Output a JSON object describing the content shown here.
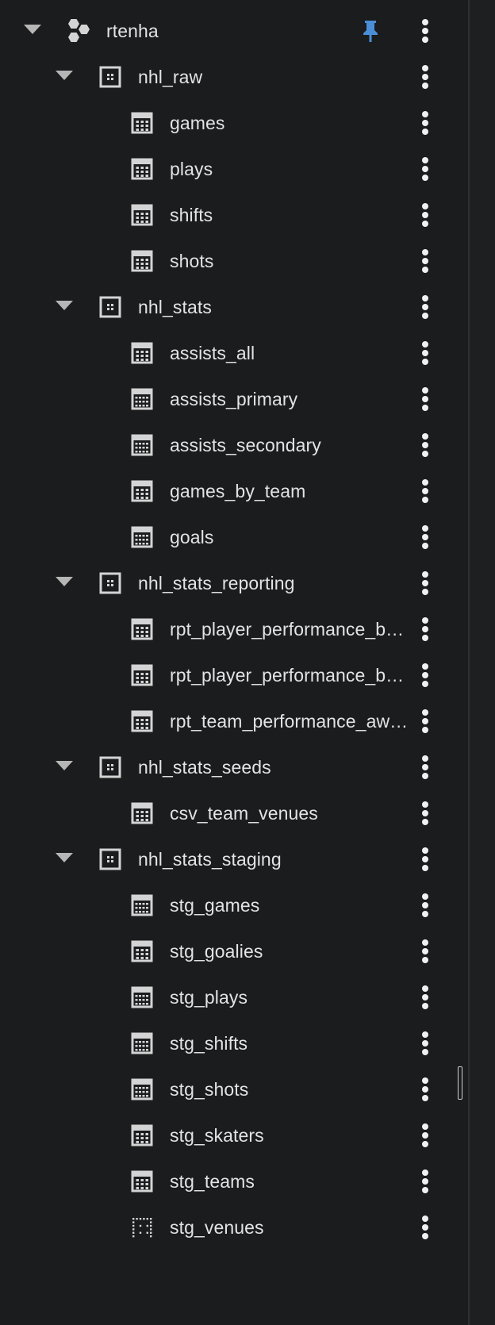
{
  "project": {
    "name": "rtenha",
    "icon": "project-hexagons-icon",
    "pinned": true,
    "pin_color": "#4a8ed8"
  },
  "datasets": [
    {
      "name": "nhl_raw",
      "tables": [
        {
          "name": "games",
          "icon": "table-icon"
        },
        {
          "name": "plays",
          "icon": "table-icon"
        },
        {
          "name": "shifts",
          "icon": "table-icon"
        },
        {
          "name": "shots",
          "icon": "table-icon"
        }
      ]
    },
    {
      "name": "nhl_stats",
      "tables": [
        {
          "name": "assists_all",
          "icon": "table-icon"
        },
        {
          "name": "assists_primary",
          "icon": "view-icon"
        },
        {
          "name": "assists_secondary",
          "icon": "view-icon"
        },
        {
          "name": "games_by_team",
          "icon": "table-icon"
        },
        {
          "name": "goals",
          "icon": "view-icon"
        }
      ]
    },
    {
      "name": "nhl_stats_reporting",
      "tables": [
        {
          "name": "rpt_player_performance_b…",
          "icon": "table-icon"
        },
        {
          "name": "rpt_player_performance_b…",
          "icon": "table-icon"
        },
        {
          "name": "rpt_team_performance_aw…",
          "icon": "table-icon"
        }
      ]
    },
    {
      "name": "nhl_stats_seeds",
      "tables": [
        {
          "name": "csv_team_venues",
          "icon": "table-icon"
        }
      ]
    },
    {
      "name": "nhl_stats_staging",
      "tables": [
        {
          "name": "stg_games",
          "icon": "view-icon"
        },
        {
          "name": "stg_goalies",
          "icon": "table-icon"
        },
        {
          "name": "stg_plays",
          "icon": "view-icon"
        },
        {
          "name": "stg_shifts",
          "icon": "view-icon"
        },
        {
          "name": "stg_shots",
          "icon": "view-icon"
        },
        {
          "name": "stg_skaters",
          "icon": "table-icon"
        },
        {
          "name": "stg_teams",
          "icon": "table-icon"
        },
        {
          "name": "stg_venues",
          "icon": "external-table-icon"
        }
      ]
    }
  ],
  "icons": {
    "expand": "chevron-down-icon",
    "dataset": "dataset-icon",
    "more": "more-vert-icon",
    "pin": "pin-icon"
  },
  "colors": {
    "background": "#1b1c1d",
    "text": "#e3e3e3",
    "icon": "#d4d4d4"
  }
}
